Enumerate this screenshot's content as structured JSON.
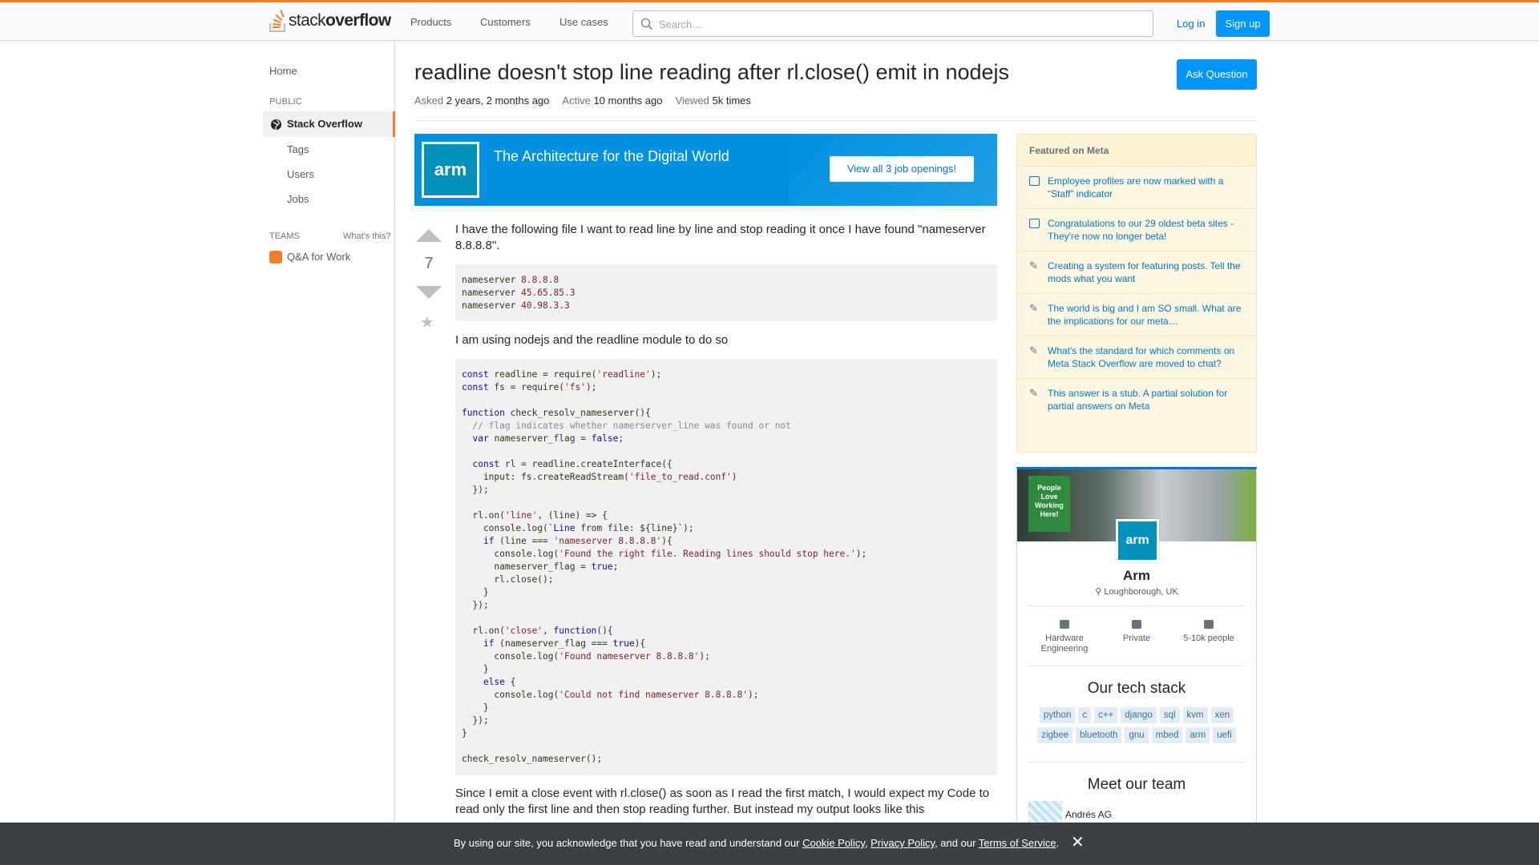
{
  "header": {
    "logo_text_light": "stack",
    "logo_text_bold": "overflow",
    "nav": [
      "Products",
      "Customers",
      "Use cases"
    ],
    "search_placeholder": "Search…",
    "login": "Log in",
    "signup": "Sign up"
  },
  "sidebar": {
    "home": "Home",
    "public": "PUBLIC",
    "stack_overflow": "Stack Overflow",
    "items": [
      "Tags",
      "Users",
      "Jobs"
    ],
    "teams": "TEAMS",
    "whats_this": "What's this?",
    "qa_for_work": "Q&A for Work"
  },
  "question": {
    "title": "readline doesn't stop line reading after rl.close() emit in nodejs",
    "ask_button": "Ask Question",
    "asked_label": "Asked",
    "asked_value": "2 years, 2 months ago",
    "active_label": "Active",
    "active_value": "10 months ago",
    "viewed_label": "Viewed",
    "viewed_value": "5k times",
    "votes": "7",
    "para1": "I have the following file I want to read line by line and stop reading it once I have found \"nameserver 8.8.8.8\".",
    "para2": "I am using nodejs and the readline module to do so",
    "para3": "Since I emit a close event with rl.close() as soon as I read the first match, I would expect my Code to read only the first line and then stop reading further. But instead my output looks like this"
  },
  "banner": {
    "logo": "arm",
    "tagline": "The Architecture for the Digital World",
    "button": "View all 3 job openings!"
  },
  "featured_meta": {
    "heading": "Featured on Meta",
    "items": [
      "Employee profiles are now marked with a “Staff” indicator",
      "Congratulations to our 29 oldest beta sites - They're now no longer beta!",
      "Creating a system for featuring posts. Tell the mods what you want",
      "The world is big and I am SO small. What are the implications for our meta…",
      "What's the standard for which comments on Meta Stack Overflow are moved to chat?",
      "This answer is a stub. A partial solution for partial answers on Meta"
    ]
  },
  "company": {
    "poster_lines": [
      "People",
      "Love",
      "Working",
      "Here!"
    ],
    "logo": "arm",
    "name": "Arm",
    "location": "Loughborough, UK",
    "facts": [
      "Hardware Engineering",
      "Private",
      "5-10k people"
    ],
    "stack_heading": "Our tech stack",
    "tags": [
      "python",
      "c",
      "c++",
      "django",
      "sql",
      "kvm",
      "xen",
      "zigbee",
      "bluetooth",
      "gnu",
      "mbed",
      "arm",
      "uefi"
    ],
    "team_heading": "Meet our team",
    "member": "Andrés AG"
  },
  "cookie": {
    "prefix": "By using our site, you acknowledge that you have read and understand our",
    "cookie_policy": "Cookie Policy",
    "comma": ",",
    "privacy_policy": "Privacy Policy",
    "and_our": ", and our",
    "terms": "Terms of Service",
    "period": ".",
    "close": "✕"
  },
  "colors": {
    "accent": "#f48024",
    "link": "#0077cc",
    "primary_button": "#0095ff",
    "banner_bg": "#0091e0",
    "meta_bg": "#fdf7e2",
    "cookie_bg": "#3b4045"
  }
}
